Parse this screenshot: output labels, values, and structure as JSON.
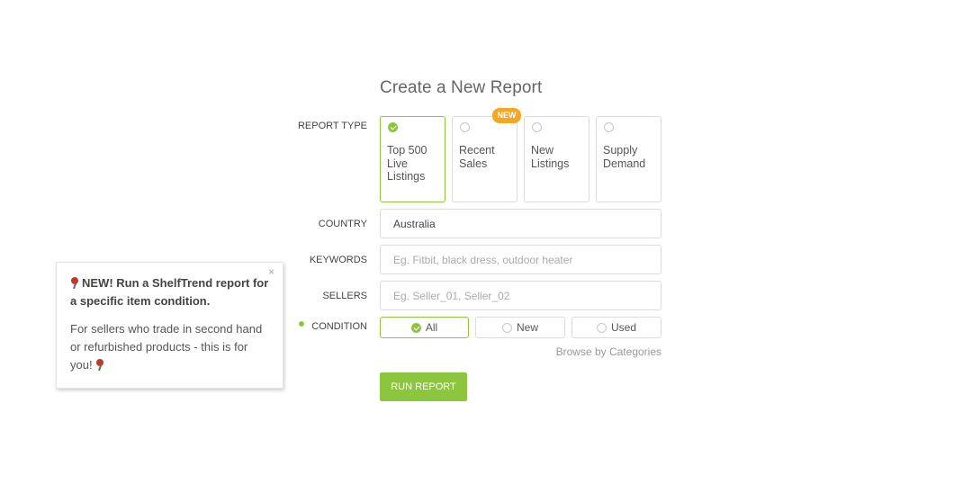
{
  "title": "Create a New Report",
  "labels": {
    "report_type": "REPORT TYPE",
    "country": "COUNTRY",
    "keywords": "KEYWORDS",
    "sellers": "SELLERS",
    "condition": "CONDITION"
  },
  "report_types": [
    {
      "label": "Top 500 Live Listings",
      "selected": true
    },
    {
      "label": "Recent Sales",
      "selected": false
    },
    {
      "label": "New Listings",
      "selected": false
    },
    {
      "label": "Supply Demand",
      "selected": false
    }
  ],
  "new_badge": "NEW",
  "country": {
    "value": "Australia"
  },
  "keywords": {
    "placeholder": "Eg. Fitbit, black dress, outdoor heater"
  },
  "sellers": {
    "placeholder": "Eg. Seller_01, Seller_02"
  },
  "conditions": [
    {
      "label": "All",
      "selected": true
    },
    {
      "label": "New",
      "selected": false
    },
    {
      "label": "Used",
      "selected": false
    }
  ],
  "browse_link": "Browse by Categories",
  "run_button": "RUN REPORT",
  "tooltip": {
    "close": "×",
    "heading": "NEW! Run a ShelfTrend report for a specific item condition.",
    "body": "For sellers who trade in second hand or refurbished products - this is for you!"
  },
  "colors": {
    "accent": "#8cc63f",
    "badge": "#f5a623"
  }
}
